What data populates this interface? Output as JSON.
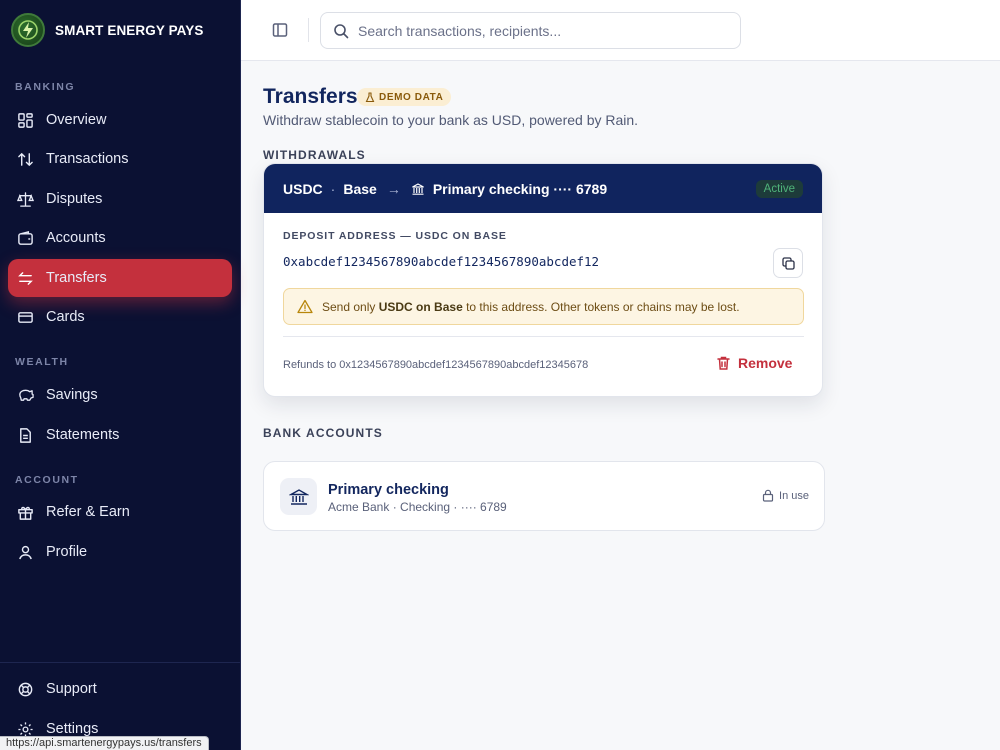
{
  "brand": {
    "name": "SMART ENERGY PAYS"
  },
  "sidebar": {
    "sections": {
      "banking": "BANKING",
      "wealth": "WEALTH",
      "account": "ACCOUNT"
    },
    "items": [
      {
        "label": "Overview",
        "icon": "grid-icon"
      },
      {
        "label": "Transactions",
        "icon": "arrows-up-down-icon"
      },
      {
        "label": "Disputes",
        "icon": "scale-icon"
      },
      {
        "label": "Accounts",
        "icon": "wallet-icon"
      },
      {
        "label": "Transfers",
        "icon": "transfer-icon",
        "active": true
      },
      {
        "label": "Cards",
        "icon": "card-icon"
      },
      {
        "label": "Savings",
        "icon": "piggy-bank-icon"
      },
      {
        "label": "Statements",
        "icon": "document-icon"
      },
      {
        "label": "Refer & Earn",
        "icon": "gift-icon"
      },
      {
        "label": "Profile",
        "icon": "user-icon"
      }
    ],
    "footer": [
      {
        "label": "Support",
        "icon": "lifebuoy-icon"
      },
      {
        "label": "Settings",
        "icon": "gear-icon"
      }
    ]
  },
  "status_url": "https://api.smartenergypays.us/transfers",
  "search": {
    "placeholder": "Search transactions, recipients..."
  },
  "page": {
    "title": "Transfers",
    "badge": "DEMO DATA",
    "subtitle": "Withdraw stablecoin to your bank as USD, powered by Rain."
  },
  "withdrawals": {
    "heading": "WITHDRAWALS",
    "token": "USDC",
    "separator": "·",
    "chain": "Base",
    "arrow": "→",
    "destination": "Primary checking ···· 6789",
    "status": "Active",
    "deposit_label": "DEPOSIT ADDRESS — USDC ON BASE",
    "deposit_address": "0xabcdef1234567890abcdef1234567890abcdef12",
    "warning_pre": "Send only ",
    "warning_bold": "USDC on Base",
    "warning_post": " to this address. Other tokens or chains may be lost.",
    "refunds": "Refunds to 0x1234567890abcdef1234567890abcdef12345678",
    "remove_label": "Remove"
  },
  "bank_accounts": {
    "heading": "BANK ACCOUNTS",
    "items": [
      {
        "name": "Primary checking",
        "meta": "Acme Bank · Checking · ···· 6789",
        "status": "In use"
      }
    ]
  },
  "colors": {
    "sidebar_bg": "#0b1133",
    "accent_red": "#c4303d",
    "navy": "#12265e",
    "card_header": "#10245e",
    "active_green": "#4fb37a"
  }
}
